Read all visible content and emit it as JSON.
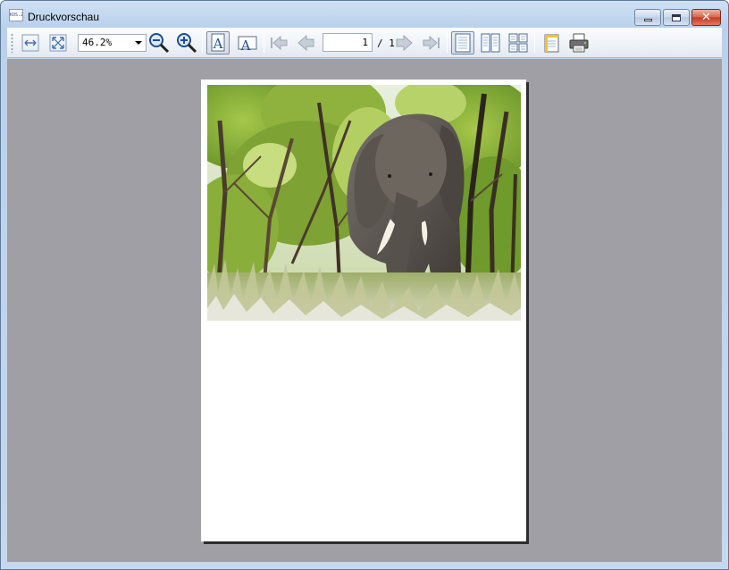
{
  "window": {
    "title": "Druckvorschau",
    "app_icon_text": "KOS.2",
    "buttons": [
      "minimize",
      "maximize",
      "close"
    ]
  },
  "toolbar": {
    "fit_width_icon": "fit-width-icon",
    "fit_page_icon": "fit-page-icon",
    "zoom_value": "46.2%",
    "zoom_out_icon": "zoom-out-icon",
    "zoom_in_icon": "zoom-in-icon",
    "portrait_icon": "portrait-icon",
    "landscape_icon": "landscape-icon",
    "first_page_icon": "first-page-icon",
    "prev_page_icon": "prev-page-icon",
    "current_page": "1",
    "page_total": "/ 1",
    "next_page_icon": "next-page-icon",
    "last_page_icon": "last-page-icon",
    "single_page_icon": "single-page-icon",
    "facing_pages_icon": "facing-pages-icon",
    "overview_icon": "overview-pages-icon",
    "page_setup_icon": "page-setup-icon",
    "print_icon": "print-icon"
  },
  "preview": {
    "background_color": "#a09fa5",
    "image_subject": "elephant"
  }
}
